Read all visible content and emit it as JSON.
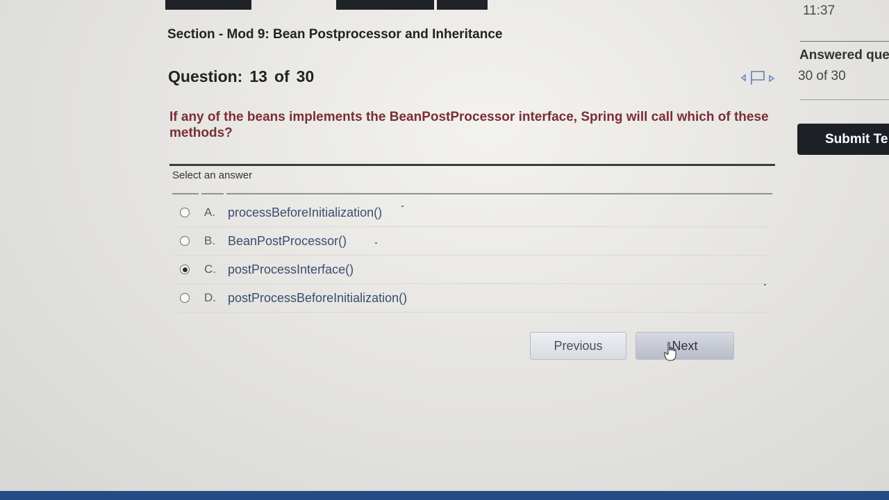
{
  "clock": "11:37",
  "section": {
    "title": "Section - Mod 9: Bean Postprocessor and Inheritance"
  },
  "question": {
    "label": "Question:",
    "number": "13",
    "of_word": "of",
    "total": "30",
    "prompt": "If any of the beans implements the BeanPostProcessor interface, Spring will call which of these methods?"
  },
  "answer_section": {
    "label": "Select an answer"
  },
  "options": [
    {
      "letter": "A.",
      "text": "processBeforeInitialization()",
      "selected": false
    },
    {
      "letter": "B.",
      "text": "BeanPostProcessor()",
      "selected": false
    },
    {
      "letter": "C.",
      "text": "postProcessInterface()",
      "selected": true
    },
    {
      "letter": "D.",
      "text": "postProcessBeforeInitialization()",
      "selected": false
    }
  ],
  "nav": {
    "previous_label": "Previous",
    "next_label": "Next"
  },
  "sidebar": {
    "answered_title": "Answered que",
    "answered_count": "30 of 30",
    "submit_label": "Submit Te"
  },
  "colors": {
    "prompt": "#7a2d36",
    "option_text": "#3a4d6e",
    "submit_bg": "#1d2127",
    "bottom_bar": "#244d86"
  },
  "icons": [
    "flag-icon",
    "previous-flag-arrow-icon",
    "next-flag-arrow-icon",
    "hand-cursor-icon"
  ]
}
